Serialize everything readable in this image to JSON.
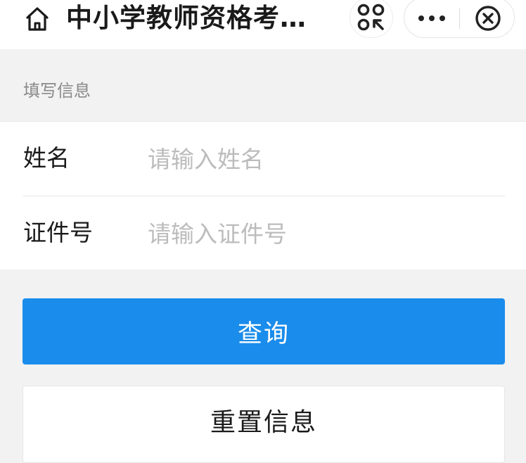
{
  "nav": {
    "title": "中小学教师资格考…",
    "home_icon": "home-icon",
    "mini_game_icon": "mini-program-icon",
    "more_icon": "more-dots-icon",
    "close_icon": "close-circle-icon"
  },
  "form": {
    "section_label": "填写信息",
    "name_label": "姓名",
    "name_placeholder": "请输入姓名",
    "name_value": "",
    "id_label": "证件号",
    "id_placeholder": "请输入证件号",
    "id_value": ""
  },
  "buttons": {
    "query_label": "查询",
    "reset_label": "重置信息"
  },
  "colors": {
    "accent": "#1a8ceb",
    "background": "#f2f2f2"
  }
}
